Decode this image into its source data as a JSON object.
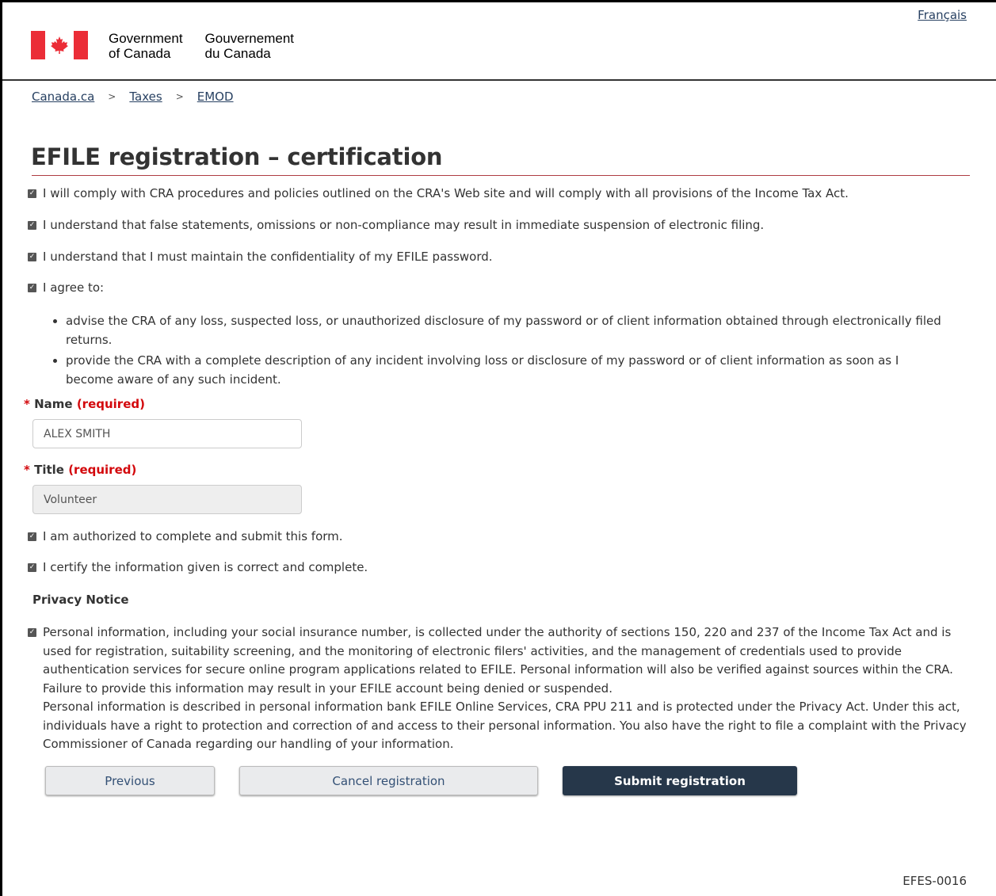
{
  "header": {
    "language_link": "Français",
    "signature_en": [
      "Government",
      "of Canada"
    ],
    "signature_fr": [
      "Gouvernement",
      "du Canada"
    ],
    "flag_icon": "maple-leaf-icon",
    "colors": {
      "flag_red": "#eb2d37",
      "heading_rule": "#af3c43",
      "link": "#284162",
      "required": "#d3080c",
      "primary_button": "#26374a"
    }
  },
  "breadcrumb": [
    "Canada.ca",
    "Taxes",
    "EMOD"
  ],
  "page_title": "EFILE registration – certification",
  "agreements": [
    "I will comply with CRA procedures and policies outlined on the CRA's Web site and will comply with all provisions of the Income Tax Act.",
    "I understand that false statements, omissions or non-compliance may result in immediate suspension of electronic filing.",
    "I understand that I must maintain the confidentiality of my EFILE password.",
    "I agree to:"
  ],
  "agree_items": [
    "advise the CRA of any loss, suspected loss, or unauthorized disclosure of my password or of client information obtained through electronically filed returns.",
    "provide the CRA with a complete description of any incident involving loss or disclosure of my password or of client information as soon as I become aware of any such incident."
  ],
  "form": {
    "required_marker": "*",
    "name_label": "Name",
    "name_required": "(required)",
    "name_value": "ALEX SMITH",
    "title_label": "Title",
    "title_required": "(required)",
    "title_value": "Volunteer"
  },
  "certifications": [
    "I am authorized to complete and submit this form.",
    "I certify the information given is correct and complete."
  ],
  "privacy": {
    "heading": "Privacy Notice",
    "paragraph1": "Personal information, including your social insurance number, is collected under the authority of sections 150, 220 and 237 of the Income Tax Act and is used for registration, suitability screening, and the monitoring of electronic filers' activities, and the management of credentials used to provide authentication services for secure online program applications related to EFILE. Personal information will also be verified against sources within the CRA. Failure to provide this information may result in your EFILE account being denied or suspended.",
    "paragraph2": "Personal information is described in personal information bank EFILE Online Services, CRA PPU 211 and is protected under the Privacy Act. Under this act, individuals have a right to protection and correction of and access to their personal information. You also have the right to file a complaint with the Privacy Commissioner of Canada regarding our handling of your information."
  },
  "buttons": {
    "previous": "Previous",
    "cancel": "Cancel registration",
    "submit": "Submit registration"
  },
  "page_code": "EFES-0016"
}
